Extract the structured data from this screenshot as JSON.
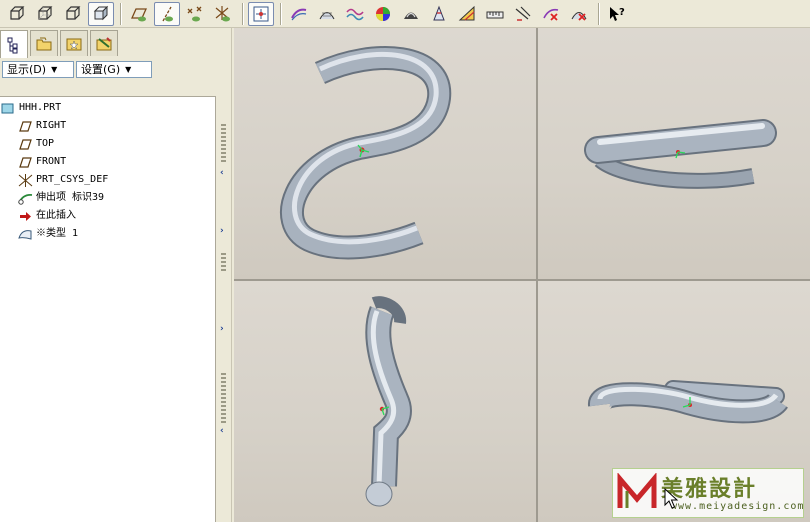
{
  "panel": {
    "menus": [
      {
        "label": "显示(D)"
      },
      {
        "label": "设置(G)"
      }
    ]
  },
  "tree": {
    "items": [
      {
        "label": "HHH.PRT",
        "icon": "part-icon"
      },
      {
        "label": "RIGHT",
        "icon": "datum-plane-icon"
      },
      {
        "label": "TOP",
        "icon": "datum-plane-icon"
      },
      {
        "label": "FRONT",
        "icon": "datum-plane-icon"
      },
      {
        "label": "PRT_CSYS_DEF",
        "icon": "coordinate-system-icon"
      },
      {
        "label": "伸出项 标识39",
        "icon": "sweep-feature-icon"
      },
      {
        "label": "在此插入",
        "icon": "insert-here-arrow-icon"
      },
      {
        "label": "※类型 1",
        "icon": "flexible-surface-icon"
      }
    ]
  },
  "watermark": {
    "brand": "美雅設計",
    "url": "www.meiyadesign.com"
  },
  "colors": {
    "tube": "#a9b3bf",
    "tube_highlight": "#e6ebf0",
    "tube_shadow": "#6e7884",
    "viewport_bg": "#d8d3ca",
    "accent": "#1d3f93"
  }
}
